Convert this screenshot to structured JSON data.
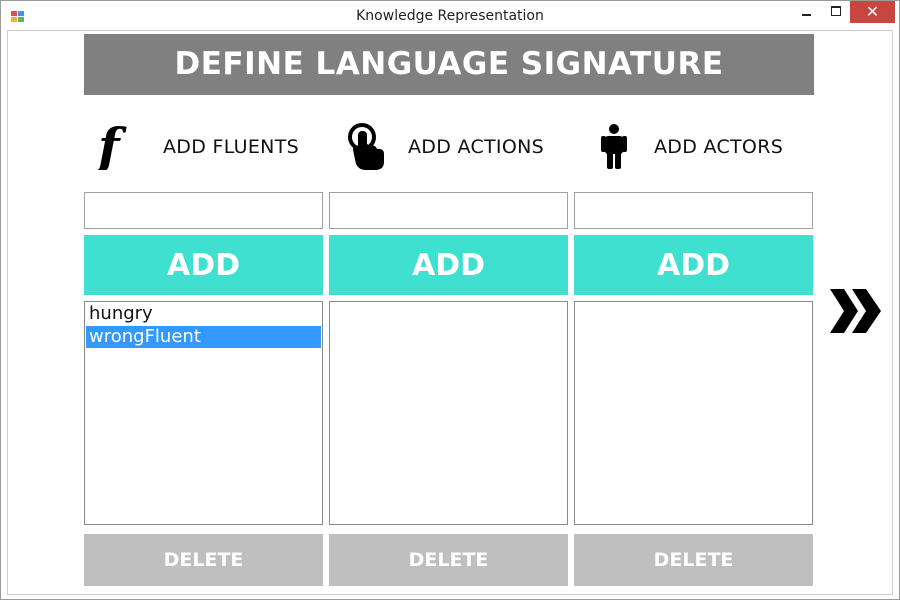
{
  "window": {
    "title": "Knowledge Representation"
  },
  "header": {
    "title": "DEFINE LANGUAGE SIGNATURE"
  },
  "columns": [
    {
      "label": "ADD FLUENTS",
      "icon": "function-f-icon",
      "input_value": "",
      "add_label": "ADD",
      "items": [
        {
          "text": "hungry",
          "selected": false
        },
        {
          "text": "wrongFluent",
          "selected": true
        }
      ],
      "delete_label": "DELETE"
    },
    {
      "label": "ADD ACTIONS",
      "icon": "hand-pointer-icon",
      "input_value": "",
      "add_label": "ADD",
      "items": [],
      "delete_label": "DELETE"
    },
    {
      "label": "ADD ACTORS",
      "icon": "person-icon",
      "input_value": "",
      "add_label": "ADD",
      "items": [],
      "delete_label": "DELETE"
    }
  ],
  "colors": {
    "header_bg": "#808080",
    "add_bg": "#40e0d0",
    "delete_bg": "#bfbfbf",
    "selection": "#3399ff",
    "close_button": "#c7463f"
  },
  "navigation": {
    "next_icon": "double-chevron-right-icon"
  }
}
